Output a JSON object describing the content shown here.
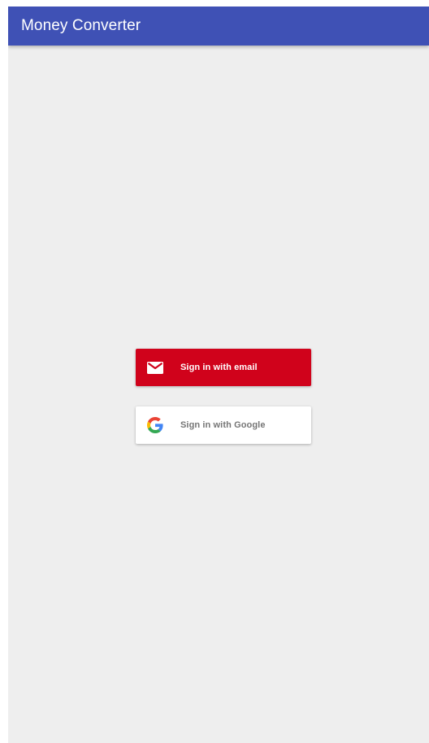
{
  "app_bar": {
    "title": "Money Converter",
    "background_color": "#3f51b5"
  },
  "screen": {
    "background_color": "#eeeeee"
  },
  "auth_buttons": [
    {
      "label": "Sign in with email",
      "icon": "mail-icon",
      "background_color": "#d0021b",
      "text_color": "#ffffff"
    },
    {
      "label": "Sign in with Google",
      "icon": "google-logo-icon",
      "background_color": "#ffffff",
      "text_color": "#757575"
    }
  ]
}
